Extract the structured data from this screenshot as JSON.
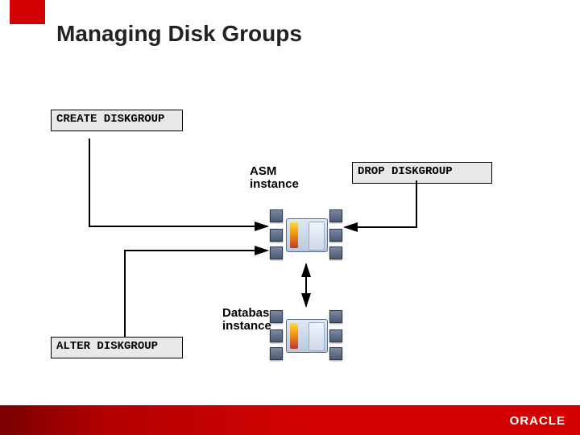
{
  "title": "Managing Disk Groups",
  "commands": {
    "create": "CREATE DISKGROUP",
    "alter": "ALTER DISKGROUP",
    "drop": "DROP DISKGROUP"
  },
  "labels": {
    "asm": "ASM instance",
    "db": "Database\ninstance"
  },
  "brand": "ORACLE",
  "colors": {
    "accent": "#d40303"
  }
}
